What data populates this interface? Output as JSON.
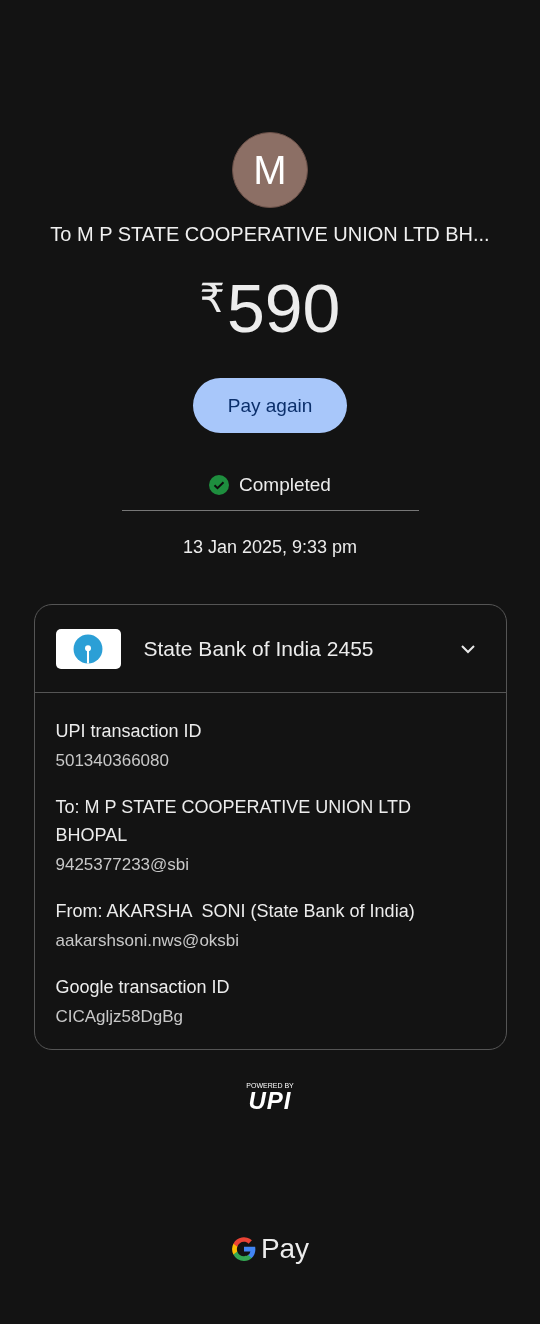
{
  "payee": {
    "initial": "M",
    "title": "To M P STATE COOPERATIVE UNION LTD BH..."
  },
  "amount": {
    "currency": "₹",
    "value": "590"
  },
  "action": {
    "label": "Pay again"
  },
  "status": {
    "kind": "completed",
    "label": "Completed"
  },
  "timestamp": "13 Jan 2025, 9:33 pm",
  "account_card": {
    "bank": "State Bank of India 2455",
    "expanded": true,
    "details": [
      {
        "label": "UPI transaction ID",
        "value": "501340366080"
      },
      {
        "label": "To: M P STATE COOPERATIVE UNION LTD BHOPAL",
        "value": "9425377233@sbi"
      },
      {
        "label": "From: AKARSHA  SONI (State Bank of India)",
        "value": "aakarshsoni.nws@oksbi"
      },
      {
        "label": "Google transaction ID",
        "value": "CICAgljz58DgBg"
      }
    ]
  },
  "upi_badge": {
    "caption": "POWERED BY",
    "mark": "UPI"
  },
  "footer": {
    "brand": "Pay"
  }
}
